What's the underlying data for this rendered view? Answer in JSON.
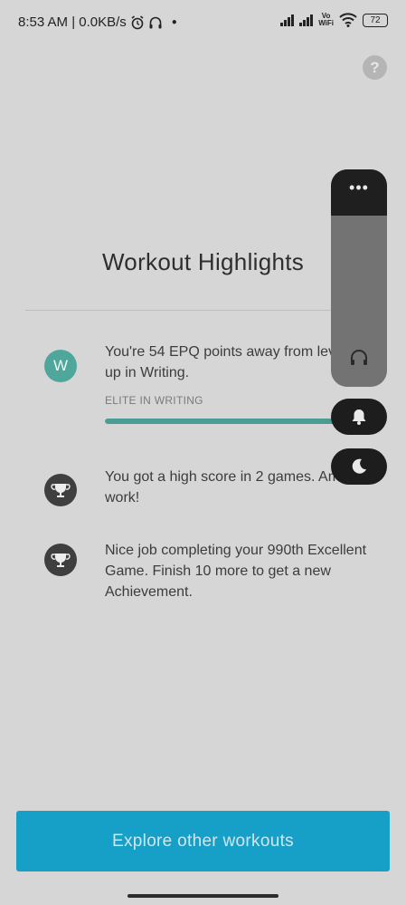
{
  "status_bar": {
    "time_speed": "8:53 AM | 0.0KB/s",
    "vowifi_top": "Vo",
    "vowifi_bottom": "WiFi",
    "battery": "72"
  },
  "title": "Workout Highlights",
  "highlights": [
    {
      "badge": "W",
      "text": "You're 54 EPQ points away from leveling up in Writing.",
      "label": "ELITE IN WRITING",
      "progress": 0.9
    },
    {
      "icon": "trophy-icon",
      "text": "You got a high score in 2 games. Amazing work!"
    },
    {
      "icon": "trophy-icon",
      "text": "Nice job completing your 990th Excellent Game. Finish 10 more to get a new Achievement."
    }
  ],
  "overlay": {
    "menu_label": "•••",
    "icons": [
      "headphones-icon",
      "bell-icon",
      "moon-icon"
    ]
  },
  "cta_label": "Explore other workouts",
  "colors": {
    "accent_teal": "#4fa79c",
    "cta_blue": "#169fc7",
    "trophy_badge": "#3f3f3f"
  }
}
